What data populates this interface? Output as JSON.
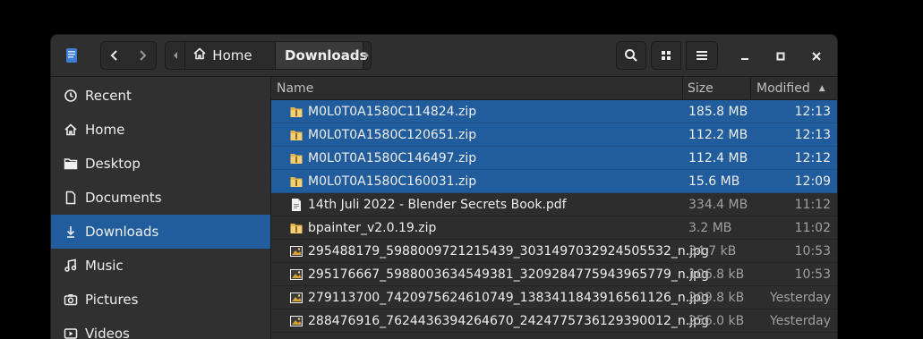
{
  "window": {
    "path": {
      "home": "Home",
      "current": "Downloads"
    }
  },
  "sidebar": {
    "items": [
      {
        "label": "Recent",
        "icon": "clock-icon"
      },
      {
        "label": "Home",
        "icon": "home-icon"
      },
      {
        "label": "Desktop",
        "icon": "folder-icon"
      },
      {
        "label": "Documents",
        "icon": "document-icon"
      },
      {
        "label": "Downloads",
        "icon": "download-icon",
        "active": true
      },
      {
        "label": "Music",
        "icon": "music-icon"
      },
      {
        "label": "Pictures",
        "icon": "camera-icon"
      },
      {
        "label": "Videos",
        "icon": "video-icon"
      }
    ]
  },
  "list": {
    "columns": {
      "name": "Name",
      "size": "Size",
      "modified": "Modified"
    },
    "rows": [
      {
        "name": "M0L0T0A1580C114824.zip",
        "size": "185.8 MB",
        "modified": "12:13",
        "type": "archive",
        "selected": true
      },
      {
        "name": "M0L0T0A1580C120651.zip",
        "size": "112.2 MB",
        "modified": "12:13",
        "type": "archive",
        "selected": true
      },
      {
        "name": "M0L0T0A1580C146497.zip",
        "size": "112.4 MB",
        "modified": "12:12",
        "type": "archive",
        "selected": true
      },
      {
        "name": "M0L0T0A1580C160031.zip",
        "size": "15.6 MB",
        "modified": "12:09",
        "type": "archive",
        "selected": true
      },
      {
        "name": "14th Juli 2022 - Blender Secrets Book.pdf",
        "size": "334.4 MB",
        "modified": "11:12",
        "type": "document",
        "selected": false
      },
      {
        "name": "bpainter_v2.0.19.zip",
        "size": "3.2 MB",
        "modified": "11:02",
        "type": "archive",
        "selected": false
      },
      {
        "name": "295488179_5988009721215439_3031497032924505532_n.jpg",
        "size": "34.7 kB",
        "modified": "10:53",
        "type": "image",
        "selected": false
      },
      {
        "name": "295176667_5988003634549381_3209284775943965779_n.jpg",
        "size": "106.8 kB",
        "modified": "10:53",
        "type": "image",
        "selected": false
      },
      {
        "name": "279113700_7420975624610749_1383411843916561126_n.jpg",
        "size": "209.8 kB",
        "modified": "Yesterday",
        "type": "image",
        "selected": false
      },
      {
        "name": "288476916_7624436394264670_2424775736129390012_n.jpg",
        "size": "256.0 kB",
        "modified": "Yesterday",
        "type": "image",
        "selected": false
      }
    ]
  },
  "colors": {
    "selection": "#215d9c",
    "window_bg": "#353535",
    "screen_bg": "#000000"
  }
}
